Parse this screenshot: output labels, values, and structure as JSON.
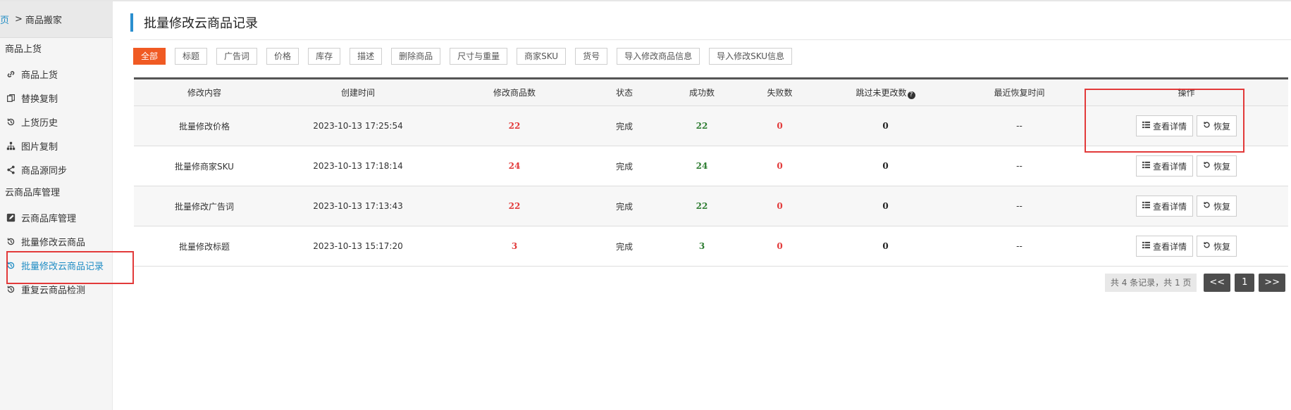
{
  "breadcrumb": {
    "home": "首页",
    "sep": ">",
    "current": "商品搬家"
  },
  "sidebar": {
    "groups": [
      {
        "title": "商品上货",
        "items": [
          {
            "label": "商品上货",
            "icon": "link-icon"
          },
          {
            "label": "替换复制",
            "icon": "copy-icon"
          },
          {
            "label": "上货历史",
            "icon": "history-icon"
          },
          {
            "label": "图片复制",
            "icon": "sitemap-icon"
          },
          {
            "label": "商品源同步",
            "icon": "share-icon"
          }
        ]
      },
      {
        "title": "云商品库管理",
        "items": [
          {
            "label": "云商品库管理",
            "icon": "edit-icon"
          },
          {
            "label": "批量修改云商品",
            "icon": "history-icon"
          },
          {
            "label": "批量修改云商品记录",
            "icon": "history-icon",
            "active": true
          },
          {
            "label": "重复云商品检测",
            "icon": "history-icon"
          }
        ]
      }
    ]
  },
  "page": {
    "title": "批量修改云商品记录"
  },
  "filters": [
    "全部",
    "标题",
    "广告词",
    "价格",
    "库存",
    "描述",
    "删除商品",
    "尺寸与重量",
    "商家SKU",
    "货号",
    "导入修改商品信息",
    "导入修改SKU信息"
  ],
  "table": {
    "headers": [
      "修改内容",
      "创建时间",
      "修改商品数",
      "状态",
      "成功数",
      "失败数",
      "跳过未更改数",
      "最近恢复时间",
      "操作"
    ],
    "rows": [
      {
        "content": "批量修改价格",
        "time": "2023-10-13 17:25:54",
        "count": "22",
        "status": "完成",
        "success": "22",
        "fail": "0",
        "skipped": "0",
        "restore_time": "--"
      },
      {
        "content": "批量修商家SKU",
        "time": "2023-10-13 17:18:14",
        "count": "24",
        "status": "完成",
        "success": "24",
        "fail": "0",
        "skipped": "0",
        "restore_time": "--"
      },
      {
        "content": "批量修改广告词",
        "time": "2023-10-13 17:13:43",
        "count": "22",
        "status": "完成",
        "success": "22",
        "fail": "0",
        "skipped": "0",
        "restore_time": "--"
      },
      {
        "content": "批量修改标题",
        "time": "2023-10-13 15:17:20",
        "count": "3",
        "status": "完成",
        "success": "3",
        "fail": "0",
        "skipped": "0",
        "restore_time": "--"
      }
    ],
    "actions": {
      "detail": "查看详情",
      "restore": "恢复"
    }
  },
  "pagination": {
    "info": "共 4 条记录，共 1 页",
    "prev": "<<",
    "current": "1",
    "next": ">>"
  },
  "colors": {
    "accent": "#f05a23",
    "link": "#1e8cc4",
    "highlight_box": "#e23a3a",
    "success": "#2e7d32"
  }
}
